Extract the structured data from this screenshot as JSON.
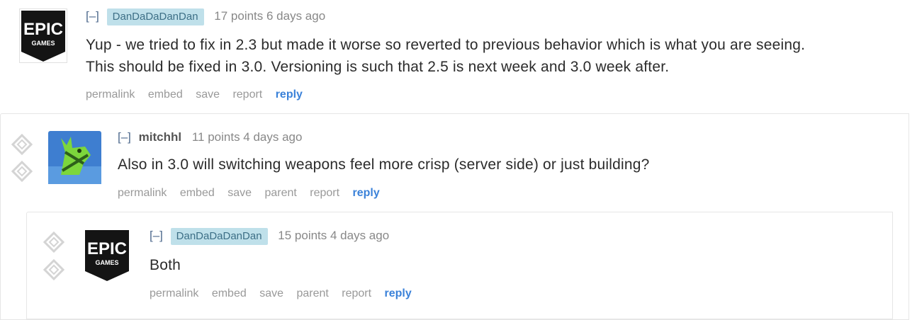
{
  "comments": [
    {
      "collapse": "[–]",
      "author": "DanDaDaDanDan",
      "score_time": "17 points 6 days ago",
      "body_line1": "Yup - we tried to fix in 2.3 but made it worse so reverted to previous behavior which is what you are seeing.",
      "body_line2": "This should be fixed in 3.0. Versioning is such that 2.5 is next week and 3.0 week after.",
      "buttons": {
        "permalink": "permalink",
        "embed": "embed",
        "save": "save",
        "report": "report",
        "reply": "reply"
      },
      "avatar": {
        "icon": "epic-games-logo",
        "line1": "EPIC",
        "line2": "GAMES"
      }
    },
    {
      "collapse": "[–]",
      "author": "mitchhl",
      "score_time": "11 points 4 days ago",
      "body": "Also in 3.0 will switching weapons feel more crisp (server side) or just building?",
      "buttons": {
        "permalink": "permalink",
        "embed": "embed",
        "save": "save",
        "parent": "parent",
        "report": "report",
        "reply": "reply"
      },
      "avatar": {
        "icon": "llama-icon"
      }
    },
    {
      "collapse": "[–]",
      "author": "DanDaDaDanDan",
      "score_time": "15 points 4 days ago",
      "body": "Both",
      "buttons": {
        "permalink": "permalink",
        "embed": "embed",
        "save": "save",
        "parent": "parent",
        "report": "report",
        "reply": "reply"
      },
      "avatar": {
        "icon": "epic-games-logo",
        "line1": "EPIC",
        "line2": "GAMES"
      }
    }
  ],
  "colors": {
    "flair_bg": "#bfe0ea",
    "flair_text": "#3d6f86",
    "reply": "#3b82d9",
    "meta": "#888888"
  }
}
